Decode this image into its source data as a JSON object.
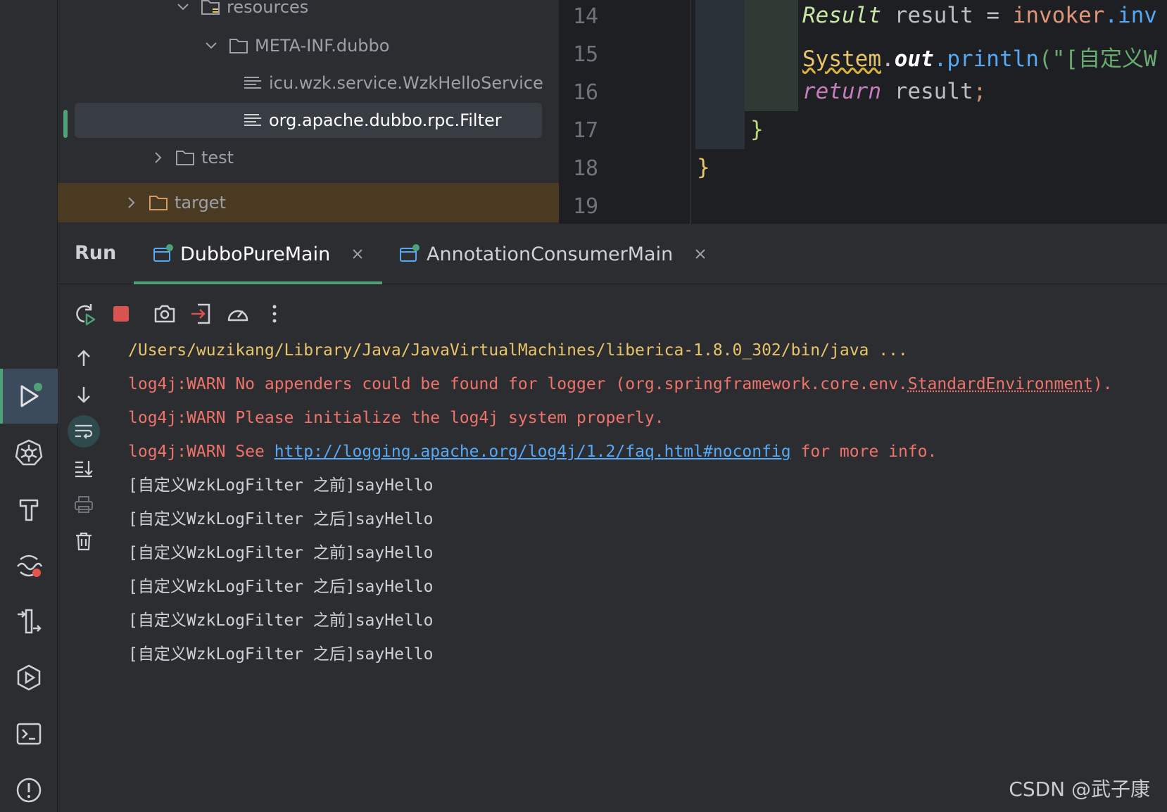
{
  "project_tree": {
    "items": [
      {
        "label": "resources",
        "type": "folder",
        "state": "expanded"
      },
      {
        "label": "META-INF.dubbo",
        "type": "folder",
        "state": "expanded"
      },
      {
        "label": "icu.wzk.service.WzkHelloService",
        "type": "file"
      },
      {
        "label": "org.apache.dubbo.rpc.Filter",
        "type": "file",
        "selected": true
      },
      {
        "label": "test",
        "type": "folder",
        "state": "collapsed"
      },
      {
        "label": "target",
        "type": "folder",
        "state": "collapsed",
        "excluded": true
      }
    ]
  },
  "editor": {
    "line_numbers": [
      "14",
      "15",
      "16",
      "17",
      "18",
      "19"
    ],
    "lines": {
      "l14": {
        "type": "Result",
        "var": "result",
        "eq": "=",
        "obj": "invoker",
        "call": ".inv"
      },
      "l15": {
        "sys": "System",
        "dot": ".",
        "out": "out",
        "call": ".println",
        "str": "(\"[自定义W"
      },
      "l16": {
        "kw": "return",
        "val": "result",
        "semi": ";"
      },
      "l17": {
        "brace": "}"
      },
      "l18": {
        "brace": "}"
      }
    }
  },
  "run_panel": {
    "title": "Run",
    "tabs": [
      {
        "label": "DubboPureMain",
        "active": true
      },
      {
        "label": "AnnotationConsumerMain",
        "active": false
      }
    ],
    "console": {
      "cmd": "/Users/wuzikang/Library/Java/JavaVirtualMachines/liberica-1.8.0_302/bin/java ...",
      "warn1_prefix": "log4j:WARN No appenders could be found for logger (org.springframework.core.env.",
      "warn1_dotted": "StandardEnvironment",
      "warn1_suffix": ").",
      "warn2": "log4j:WARN Please initialize the log4j system properly.",
      "warn3_prefix": "log4j:WARN See ",
      "warn3_link": "http://logging.apache.org/log4j/1.2/faq.html#noconfig",
      "warn3_suffix": " for more info.",
      "output": [
        "[自定义WzkLogFilter 之前]sayHello",
        "[自定义WzkLogFilter 之后]sayHello",
        "[自定义WzkLogFilter 之前]sayHello",
        "[自定义WzkLogFilter 之后]sayHello",
        "[自定义WzkLogFilter 之前]sayHello",
        "[自定义WzkLogFilter 之后]sayHello"
      ]
    }
  },
  "watermark": "CSDN @武子康",
  "colors": {
    "accent": "#4ea178",
    "warn_text": "#f0736b",
    "link": "#57a8f5",
    "command": "#e8c46a",
    "stop": "#d9534f"
  },
  "icons": {
    "strip": [
      "run-icon",
      "kubernetes-icon",
      "build-icon",
      "profiler-icon",
      "git-icon",
      "services-icon",
      "terminal-icon",
      "problems-icon"
    ],
    "toolbar": [
      "rerun-icon",
      "stop-icon",
      "screenshot-icon",
      "exit-icon",
      "coverage-icon",
      "more-icon"
    ],
    "side": [
      "scroll-up-icon",
      "scroll-down-icon",
      "soft-wrap-icon",
      "scroll-end-icon",
      "print-icon",
      "trash-icon"
    ]
  }
}
